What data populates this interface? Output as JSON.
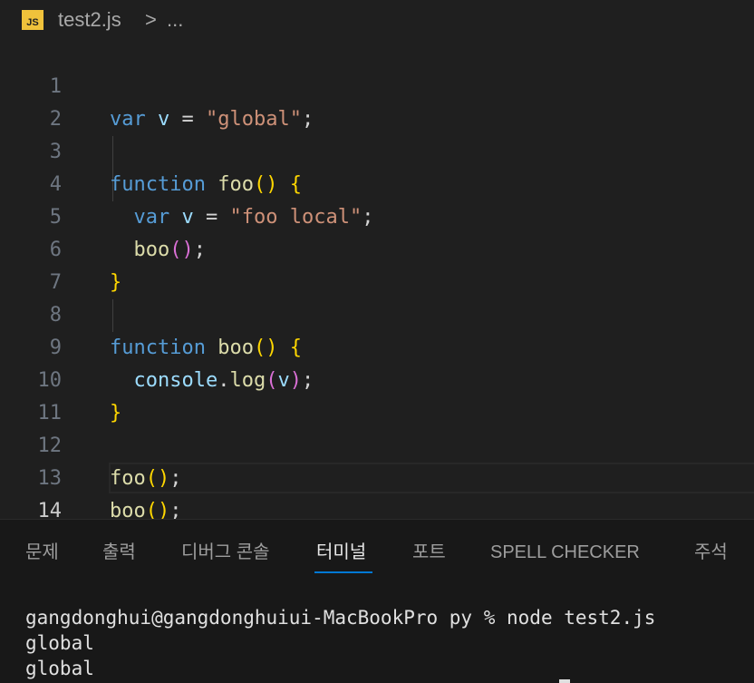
{
  "breadcrumb": {
    "file_icon_text": "JS",
    "file_name": "test2.js",
    "separator": ">",
    "more": "..."
  },
  "editor": {
    "active_line": 14,
    "line_numbers": [
      "1",
      "2",
      "3",
      "4",
      "5",
      "6",
      "7",
      "8",
      "9",
      "10",
      "11",
      "12",
      "13",
      "14"
    ],
    "lines": [
      "var v = \"global\";",
      "",
      "function foo() {",
      "  var v = \"foo local\";",
      "  boo();",
      "}",
      "",
      "function boo() {",
      "  console.log(v);",
      "}",
      "",
      "foo();",
      "boo();",
      ""
    ],
    "tokens": {
      "var": "var",
      "v": "v",
      "eq": "=",
      "str_global": "\"global\"",
      "semi": ";",
      "function": "function",
      "foo": "foo",
      "boo": "boo",
      "parens": "()",
      "open_brace": "{",
      "close_brace": "}",
      "str_foo_local": "\"foo local\"",
      "console": "console",
      "dot": ".",
      "log": "log",
      "lparen": "(",
      "rparen": ")"
    }
  },
  "panel": {
    "tabs": [
      {
        "label": "문제",
        "active": false
      },
      {
        "label": "출력",
        "active": false
      },
      {
        "label": "디버그 콘솔",
        "active": false
      },
      {
        "label": "터미널",
        "active": true
      },
      {
        "label": "포트",
        "active": false
      },
      {
        "label": "SPELL CHECKER",
        "active": false
      },
      {
        "label": "주석",
        "active": false
      }
    ],
    "terminal": {
      "lines": [
        "gangdonghui@gangdonghuiui-MacBookPro py % node test2.js",
        "global",
        "global"
      ]
    }
  },
  "colors": {
    "background": "#1f1f1f",
    "keyword": "#569cd6",
    "variable": "#9cdcfe",
    "string": "#ce9178",
    "function": "#dcdcaa",
    "bracket_1": "#ffd700",
    "bracket_2": "#da70d6",
    "active_tab_underline": "#0078d4",
    "js_icon": "#f0c23b"
  }
}
